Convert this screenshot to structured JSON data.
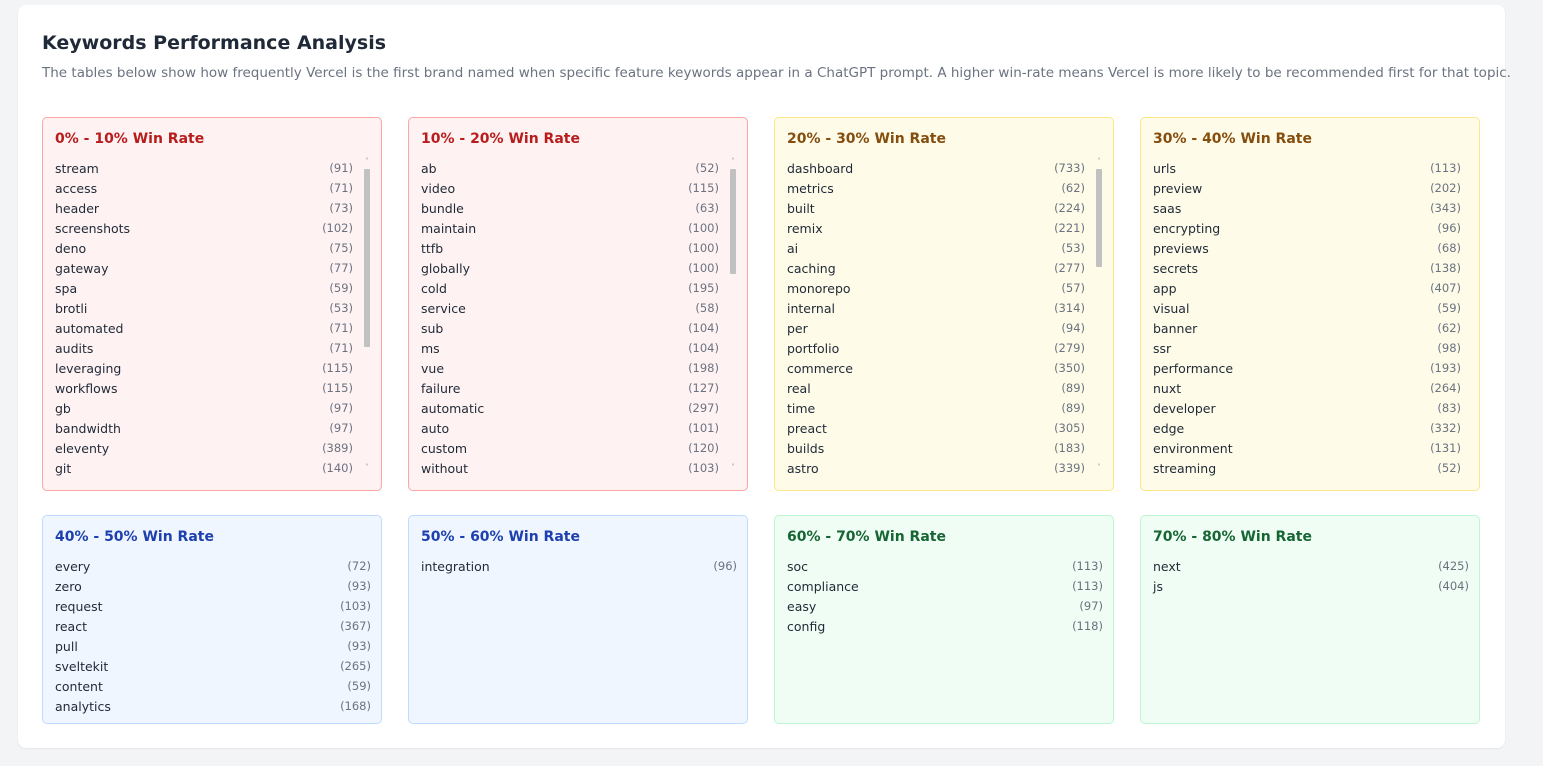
{
  "header": {
    "title": "Keywords Performance Analysis",
    "description": "The tables below show how frequently Vercel is the first brand named when specific feature keywords appear in a ChatGPT prompt. A higher win-rate means Vercel is more likely to be recommended first for that topic."
  },
  "colors": {
    "red_bg": "#fef2f2",
    "red_border": "#fca5a5",
    "red_text": "#b91c1c",
    "yellow_bg": "#fefce8",
    "yellow_border": "#fde68a",
    "yellow_text": "#854d0e",
    "blue_bg": "#eff6ff",
    "blue_border": "#bfdbfe",
    "blue_text": "#1e40af",
    "green_bg": "#f0fdf4",
    "green_border": "#bbf7d0",
    "green_text": "#166534"
  },
  "groups": [
    {
      "title": "0% - 10% Win Rate",
      "scroll_fraction": 0.0,
      "keywords": [
        {
          "word": "stream",
          "count": "(91)"
        },
        {
          "word": "access",
          "count": "(71)"
        },
        {
          "word": "header",
          "count": "(73)"
        },
        {
          "word": "screenshots",
          "count": "(102)"
        },
        {
          "word": "deno",
          "count": "(75)"
        },
        {
          "word": "gateway",
          "count": "(77)"
        },
        {
          "word": "spa",
          "count": "(59)"
        },
        {
          "word": "brotli",
          "count": "(53)"
        },
        {
          "word": "automated",
          "count": "(71)"
        },
        {
          "word": "audits",
          "count": "(71)"
        },
        {
          "word": "leveraging",
          "count": "(115)"
        },
        {
          "word": "workflows",
          "count": "(115)"
        },
        {
          "word": "gb",
          "count": "(97)"
        },
        {
          "word": "bandwidth",
          "count": "(97)"
        },
        {
          "word": "eleventy",
          "count": "(389)"
        },
        {
          "word": "git",
          "count": "(140)"
        }
      ]
    },
    {
      "title": "10% - 20% Win Rate",
      "scroll_fraction": 0.0,
      "keywords": [
        {
          "word": "ab",
          "count": "(52)"
        },
        {
          "word": "video",
          "count": "(115)"
        },
        {
          "word": "bundle",
          "count": "(63)"
        },
        {
          "word": "maintain",
          "count": "(100)"
        },
        {
          "word": "ttfb",
          "count": "(100)"
        },
        {
          "word": "globally",
          "count": "(100)"
        },
        {
          "word": "cold",
          "count": "(195)"
        },
        {
          "word": "service",
          "count": "(58)"
        },
        {
          "word": "sub",
          "count": "(104)"
        },
        {
          "word": "ms",
          "count": "(104)"
        },
        {
          "word": "vue",
          "count": "(198)"
        },
        {
          "word": "failure",
          "count": "(127)"
        },
        {
          "word": "automatic",
          "count": "(297)"
        },
        {
          "word": "auto",
          "count": "(101)"
        },
        {
          "word": "custom",
          "count": "(120)"
        },
        {
          "word": "without",
          "count": "(103)"
        }
      ]
    },
    {
      "title": "20% - 30% Win Rate",
      "scroll_fraction": 0.0,
      "keywords": [
        {
          "word": "dashboard",
          "count": "(733)"
        },
        {
          "word": "metrics",
          "count": "(62)"
        },
        {
          "word": "built",
          "count": "(224)"
        },
        {
          "word": "remix",
          "count": "(221)"
        },
        {
          "word": "ai",
          "count": "(53)"
        },
        {
          "word": "caching",
          "count": "(277)"
        },
        {
          "word": "monorepo",
          "count": "(57)"
        },
        {
          "word": "internal",
          "count": "(314)"
        },
        {
          "word": "per",
          "count": "(94)"
        },
        {
          "word": "portfolio",
          "count": "(279)"
        },
        {
          "word": "commerce",
          "count": "(350)"
        },
        {
          "word": "real",
          "count": "(89)"
        },
        {
          "word": "time",
          "count": "(89)"
        },
        {
          "word": "preact",
          "count": "(305)"
        },
        {
          "word": "builds",
          "count": "(183)"
        },
        {
          "word": "astro",
          "count": "(339)"
        }
      ]
    },
    {
      "title": "30% - 40% Win Rate",
      "keywords": [
        {
          "word": "urls",
          "count": "(113)"
        },
        {
          "word": "preview",
          "count": "(202)"
        },
        {
          "word": "saas",
          "count": "(343)"
        },
        {
          "word": "encrypting",
          "count": "(96)"
        },
        {
          "word": "previews",
          "count": "(68)"
        },
        {
          "word": "secrets",
          "count": "(138)"
        },
        {
          "word": "app",
          "count": "(407)"
        },
        {
          "word": "visual",
          "count": "(59)"
        },
        {
          "word": "banner",
          "count": "(62)"
        },
        {
          "word": "ssr",
          "count": "(98)"
        },
        {
          "word": "performance",
          "count": "(193)"
        },
        {
          "word": "nuxt",
          "count": "(264)"
        },
        {
          "word": "developer",
          "count": "(83)"
        },
        {
          "word": "edge",
          "count": "(332)"
        },
        {
          "word": "environment",
          "count": "(131)"
        },
        {
          "word": "streaming",
          "count": "(52)"
        }
      ]
    },
    {
      "title": "40% - 50% Win Rate",
      "keywords": [
        {
          "word": "every",
          "count": "(72)"
        },
        {
          "word": "zero",
          "count": "(93)"
        },
        {
          "word": "request",
          "count": "(103)"
        },
        {
          "word": "react",
          "count": "(367)"
        },
        {
          "word": "pull",
          "count": "(93)"
        },
        {
          "word": "sveltekit",
          "count": "(265)"
        },
        {
          "word": "content",
          "count": "(59)"
        },
        {
          "word": "analytics",
          "count": "(168)"
        }
      ]
    },
    {
      "title": "50% - 60% Win Rate",
      "keywords": [
        {
          "word": "integration",
          "count": "(96)"
        }
      ]
    },
    {
      "title": "60% - 70% Win Rate",
      "keywords": [
        {
          "word": "soc",
          "count": "(113)"
        },
        {
          "word": "compliance",
          "count": "(113)"
        },
        {
          "word": "easy",
          "count": "(97)"
        },
        {
          "word": "config",
          "count": "(118)"
        }
      ]
    },
    {
      "title": "70% - 80% Win Rate",
      "keywords": [
        {
          "word": "next",
          "count": "(425)"
        },
        {
          "word": "js",
          "count": "(404)"
        }
      ]
    }
  ]
}
